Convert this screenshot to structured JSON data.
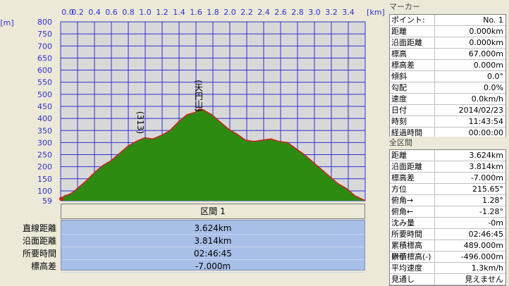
{
  "chart_data": {
    "type": "area",
    "x_unit": "[km]",
    "y_unit": "[m]",
    "x_ticks": [
      "0.0",
      "0.2",
      "0.4",
      "0.6",
      "0.8",
      "1.0",
      "1.2",
      "1.4",
      "1.6",
      "1.8",
      "2.0",
      "2.2",
      "2.4",
      "2.6",
      "2.8",
      "3.0",
      "3.2",
      "3.4"
    ],
    "y_ticks": [
      "800",
      "750",
      "700",
      "650",
      "600",
      "550",
      "500",
      "450",
      "400",
      "350",
      "300",
      "250",
      "200",
      "150",
      "100",
      "59"
    ],
    "xlim": [
      0,
      3.624
    ],
    "ylim": [
      59,
      800
    ],
    "grid": true,
    "fill_color": "#2e8b12",
    "line_color": "#d02020",
    "plot_bg": "#d8d8d8",
    "x": [
      0.0,
      0.05,
      0.1,
      0.15,
      0.2,
      0.3,
      0.4,
      0.5,
      0.6,
      0.7,
      0.8,
      0.9,
      1.0,
      1.1,
      1.2,
      1.3,
      1.4,
      1.5,
      1.6,
      1.65,
      1.7,
      1.8,
      1.9,
      2.0,
      2.1,
      2.2,
      2.3,
      2.4,
      2.5,
      2.6,
      2.7,
      2.8,
      2.9,
      3.0,
      3.1,
      3.2,
      3.3,
      3.4,
      3.5,
      3.624
    ],
    "y": [
      67,
      80,
      85,
      95,
      110,
      140,
      175,
      205,
      225,
      255,
      285,
      305,
      320,
      315,
      330,
      350,
      385,
      415,
      425,
      440,
      435,
      415,
      385,
      355,
      335,
      310,
      305,
      310,
      315,
      305,
      300,
      275,
      250,
      220,
      190,
      160,
      130,
      110,
      80,
      60
    ],
    "annotations": [
      {
        "x": 0.95,
        "y": 430,
        "text": "(313)"
      },
      {
        "x": 1.64,
        "y": 560,
        "text": "(天円山)"
      }
    ]
  },
  "section": {
    "header": "区間 1",
    "labels": [
      "直線距離",
      "沿面距離",
      "所要時間",
      "標高差"
    ],
    "values": [
      "3.624km",
      "3.814km",
      "02:46:45",
      "-7.000m"
    ]
  },
  "marker_panel": {
    "title": "マーカー",
    "rows": [
      {
        "label": "ポイント:",
        "value": "No. 1"
      },
      {
        "label": "距離",
        "value": "0.000km"
      },
      {
        "label": "沿面距離",
        "value": "0.000km"
      },
      {
        "label": "標高",
        "value": "67.000m"
      },
      {
        "label": "標高差",
        "value": "0.000m"
      },
      {
        "label": "傾斜",
        "value": "0.0°"
      },
      {
        "label": "勾配",
        "value": "0.0%"
      },
      {
        "label": "速度",
        "value": "0.0km/h"
      },
      {
        "label": "日付",
        "value": "2014/02/23"
      },
      {
        "label": "時刻",
        "value": "11:43:54"
      },
      {
        "label": "経過時間",
        "value": "00:00:00"
      }
    ]
  },
  "total_panel": {
    "title": "全区間",
    "rows": [
      {
        "label": "距離",
        "value": "3.624km"
      },
      {
        "label": "沿面距離",
        "value": "3.814km"
      },
      {
        "label": "標高差",
        "value": "-7.000m"
      },
      {
        "label": "方位",
        "value": "215.65°"
      },
      {
        "label": "俯角→",
        "value": "1.28°"
      },
      {
        "label": "俯角←",
        "value": "-1.28°"
      },
      {
        "label": "沈み量",
        "value": "-0m"
      },
      {
        "label": "所要時間",
        "value": "02:46:45"
      },
      {
        "label": "累積標高(+)",
        "value": "489.000m"
      },
      {
        "label": "累積標高(-)",
        "value": "-496.000m"
      },
      {
        "label": "平均速度",
        "value": "1.3km/h"
      },
      {
        "label": "見通し",
        "value": "見えません"
      }
    ]
  }
}
